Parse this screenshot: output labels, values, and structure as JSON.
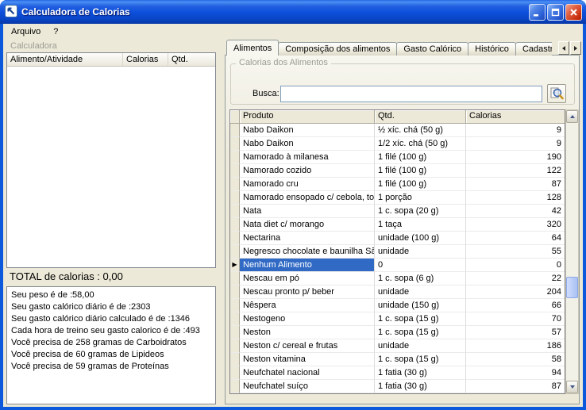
{
  "window": {
    "title": "Calculadora de Calorias"
  },
  "colors": {
    "titlebar": "#0054E3",
    "selection": "#316AC5",
    "window_face": "#ECE9D8"
  },
  "menu": {
    "items": [
      {
        "label": "Arquivo"
      },
      {
        "label": "?"
      }
    ]
  },
  "calculadora": {
    "group_label": "Calculadora",
    "columns": [
      "Alimento/Atividade",
      "Calorias",
      "Qtd."
    ],
    "total_text": "TOTAL de calorias : 0,00",
    "info_lines": [
      "Seu peso é de :58,00",
      "Seu gasto calórico diário é de :2303",
      "Seu gasto calórico diário calculado é de :1346",
      "Cada hora de treino seu gasto calorico é de :493",
      "Você precisa de 258 gramas de Carboidratos",
      "Você precisa de 60 gramas de Lipideos",
      "Você precisa de 59 gramas de Proteínas"
    ]
  },
  "tabs": [
    {
      "label": "Alimentos",
      "active": true
    },
    {
      "label": "Composição dos alimentos",
      "active": false
    },
    {
      "label": "Gasto Calórico",
      "active": false
    },
    {
      "label": "Histórico",
      "active": false
    },
    {
      "label": "Cadastr",
      "active": false
    }
  ],
  "alimentos_tab": {
    "group_label": "Calorias dos Alimentos",
    "search_label": "Busca:",
    "search_value": ""
  },
  "grid": {
    "headers": [
      "Produto",
      "Qtd.",
      "Calorias"
    ],
    "rows": [
      {
        "produto": "Nabo Daikon",
        "qtd": "½ xíc. chá (50 g)",
        "calorias": "9"
      },
      {
        "produto": "Nabo Daikon",
        "qtd": "1/2 xíc. chá (50 g)",
        "calorias": "9"
      },
      {
        "produto": "Namorado à milanesa",
        "qtd": "1 filé (100 g)",
        "calorias": "190"
      },
      {
        "produto": "Namorado cozido",
        "qtd": "1 filé (100 g)",
        "calorias": "122"
      },
      {
        "produto": "Namorado cru",
        "qtd": "1 filé (100 g)",
        "calorias": "87"
      },
      {
        "produto": "Namorado ensopado c/ cebola, tomat",
        "qtd": "1 porção",
        "calorias": "128"
      },
      {
        "produto": "Nata",
        "qtd": "1 c. sopa (20 g)",
        "calorias": "42"
      },
      {
        "produto": "Nata diet c/ morango",
        "qtd": "1 taça",
        "calorias": "320"
      },
      {
        "produto": "Nectarina",
        "qtd": "unidade (100 g)",
        "calorias": "64"
      },
      {
        "produto": "Negresco chocolate e baunilha São Lu",
        "qtd": "unidade",
        "calorias": "55"
      },
      {
        "produto": "Nenhum Alimento",
        "qtd": "0",
        "calorias": "0",
        "selected": true
      },
      {
        "produto": "Nescau em pó",
        "qtd": "1 c. sopa (6 g)",
        "calorias": "22"
      },
      {
        "produto": "Nescau pronto p/ beber",
        "qtd": "unidade",
        "calorias": "204"
      },
      {
        "produto": "Nêspera",
        "qtd": "unidade (150 g)",
        "calorias": "66"
      },
      {
        "produto": "Nestogeno",
        "qtd": "1 c. sopa (15 g)",
        "calorias": "70"
      },
      {
        "produto": "Neston",
        "qtd": "1 c. sopa (15 g)",
        "calorias": "57"
      },
      {
        "produto": "Neston c/ cereal e frutas",
        "qtd": "unidade",
        "calorias": "186"
      },
      {
        "produto": "Neston vitamina",
        "qtd": "1 c. sopa (15 g)",
        "calorias": "58"
      },
      {
        "produto": "Neufchatel nacional",
        "qtd": "1 fatia (30 g)",
        "calorias": "94"
      },
      {
        "produto": "Neufchatel suíço",
        "qtd": "1 fatia (30 g)",
        "calorias": "87"
      }
    ]
  }
}
